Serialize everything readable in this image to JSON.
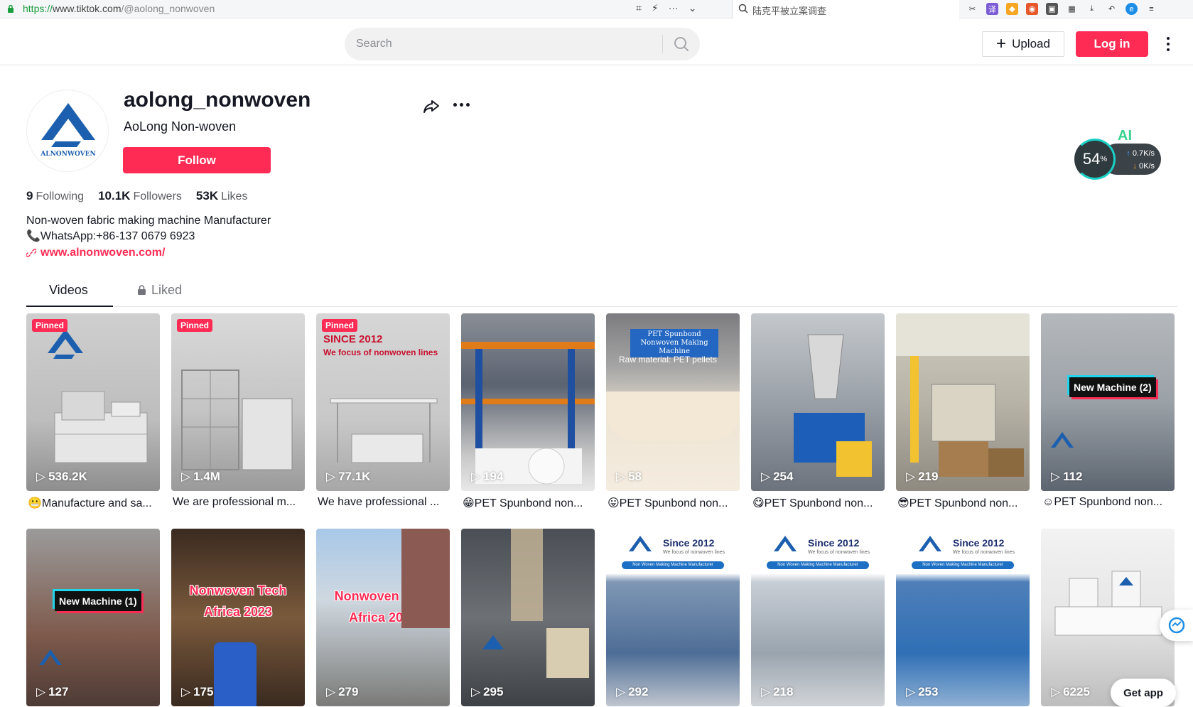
{
  "browser": {
    "url_proto": "https://",
    "url_host": "www.tiktok.com",
    "url_path": "/@aolong_nonwoven",
    "search_text": "陆克平被立案调查"
  },
  "header": {
    "search_placeholder": "Search",
    "upload_label": "Upload",
    "login_label": "Log in"
  },
  "profile": {
    "username": "aolong_nonwoven",
    "nickname": "AoLong Non-woven",
    "follow_label": "Follow",
    "following_count": "9",
    "following_label": "Following",
    "followers_count": "10.1K",
    "followers_label": "Followers",
    "likes_count": "53K",
    "likes_label": "Likes",
    "bio_line1": "Non-woven fabric making machine Manufacturer",
    "bio_line2": "📞WhatsApp:+86-137 0679 6923",
    "link": "www.alnonwoven.com/",
    "avatar_text": "ALNONWOVEN"
  },
  "widget": {
    "ai": "AI",
    "percent": "54",
    "percent_unit": "%",
    "up": "0.7K/s",
    "down": "0K/s"
  },
  "tabs": {
    "videos": "Videos",
    "liked": "Liked"
  },
  "videos": [
    {
      "views": "536.2K",
      "caption": "😬Manufacture and sa...",
      "pinned": "Pinned"
    },
    {
      "views": "1.4M",
      "caption": "We are professional m...",
      "pinned": "Pinned"
    },
    {
      "views": "77.1K",
      "caption": "We have professional ...",
      "pinned": "Pinned",
      "title": "SINCE 2012",
      "subtitle": "We focus of nonwoven lines"
    },
    {
      "views": "194",
      "caption": "😁PET Spunbond non..."
    },
    {
      "views": "58",
      "caption": "😛PET Spunbond non...",
      "title": "PET Spunbond Nonwoven Making Machine",
      "subtitle": "Raw material: PET pellets"
    },
    {
      "views": "254",
      "caption": "😋PET Spunbond non..."
    },
    {
      "views": "219",
      "caption": "😎PET Spunbond non..."
    },
    {
      "views": "112",
      "caption": "☺PET Spunbond non...",
      "tag": "New Machine (2)"
    },
    {
      "views": "127",
      "caption": "",
      "tag": "New Machine (1)"
    },
    {
      "views": "175",
      "caption": "",
      "title": "Nonwoven Tech Africa 2023"
    },
    {
      "views": "279",
      "caption": "",
      "title": "Nonwoven Tech Africa 2023"
    },
    {
      "views": "295",
      "caption": ""
    },
    {
      "views": "292",
      "caption": "",
      "since": "Since 2012",
      "since_sub": "We focus of nonwoven lines",
      "since_bar": "Non Woven Making Machine Manufacturer"
    },
    {
      "views": "218",
      "caption": "",
      "since": "Since 2012",
      "since_sub": "We focus of nonwoven lines",
      "since_bar": "Non Woven Making Machine Manufacturer"
    },
    {
      "views": "253",
      "caption": "",
      "since": "Since 2012",
      "since_sub": "We focus of nonwoven lines",
      "since_bar": "Non Woven Making Machine Manufacturer"
    },
    {
      "views": "6225",
      "caption": ""
    }
  ],
  "getapp_label": "Get app",
  "colors": {
    "accent": "#fe2c55",
    "link": "#2b5db9"
  }
}
